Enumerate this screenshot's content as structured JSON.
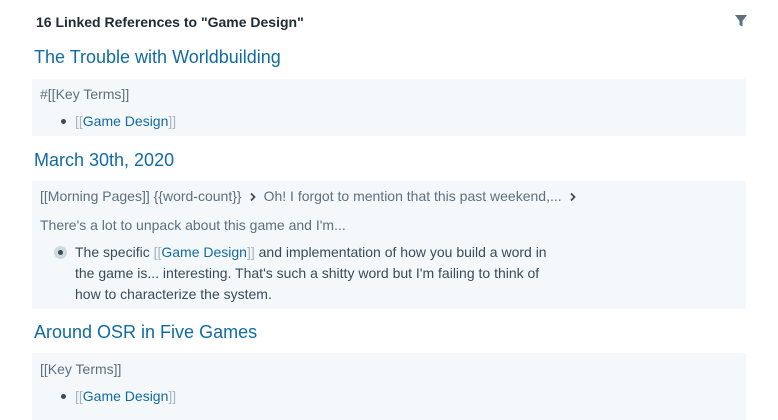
{
  "header": {
    "title": "16 Linked References to \"Game Design\""
  },
  "icons": {
    "filter": "filter-icon",
    "breadcrumb_separator": "chevron-right-icon"
  },
  "colors": {
    "link": "#106ba3",
    "block_bg": "#f5f8fa",
    "bracket": "#a7b6c2"
  },
  "references": [
    {
      "page_title": "The Trouble with Worldbuilding",
      "parent_line": "#[[Key Terms]]",
      "child": {
        "link_text": "Game Design"
      }
    },
    {
      "page_title": "March 30th, 2020",
      "breadcrumb": {
        "item1": "[[Morning Pages]] {{word-count}}",
        "item2": "Oh! I forgot to mention that this past weekend,..."
      },
      "parent_line": "There's a lot to unpack about this game and I'm...",
      "child": {
        "before": "The specific ",
        "link_text": "Game Design",
        "after_line1": " and implementation of how you build a word in",
        "line2": "the game is... interesting. That's such a shitty word but I'm failing to think of",
        "line3": "how to characterize the system."
      }
    },
    {
      "page_title": "Around OSR in Five Games",
      "parent_line": "[[Key Terms]]",
      "child": {
        "link_text": "Game Design"
      }
    }
  ],
  "brackets": {
    "open": "[[",
    "close": "]]"
  }
}
